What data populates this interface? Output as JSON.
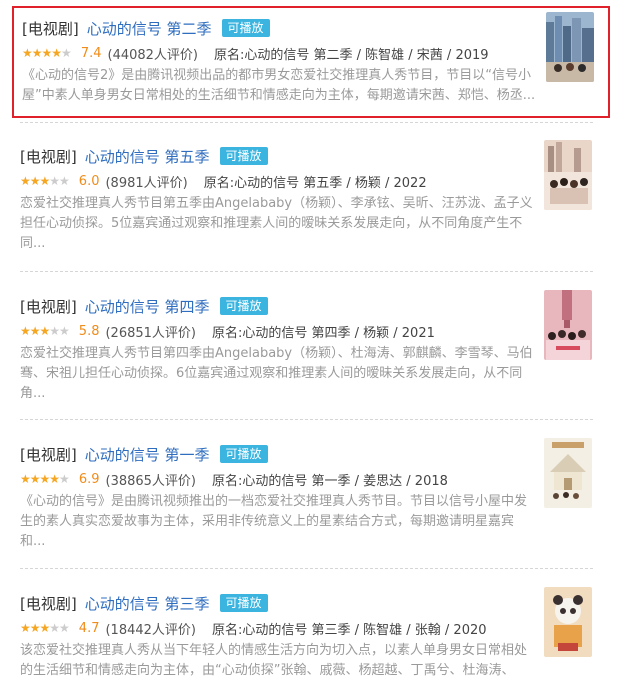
{
  "results": [
    {
      "category": "[电视剧]",
      "title": "心动的信号 第二季",
      "badge": "可播放",
      "score": "7.4",
      "count": "(44082人评价)",
      "original": "原名:心动的信号 第二季 / 陈智雄 / 宋茜 / 2019",
      "desc": "《心动的信号2》是由腾讯视频出品的都市男女恋爱社交推理真人秀节目，节目以“信号小屋”中素人单身男女日常相处的生活细节和情感走向为主体，每期邀请宋茜、郑恺、杨丞...",
      "stars": 3.5,
      "poster_icon": "poster-city-skyline"
    },
    {
      "category": "[电视剧]",
      "title": "心动的信号 第五季",
      "badge": "可播放",
      "score": "6.0",
      "count": "(8981人评价)",
      "original": "原名:心动的信号 第五季 / 杨颖 / 2022",
      "desc": "恋爱社交推理真人秀节目第五季由Angelababy（杨颖）、李承铉、吴昕、汪苏泷、孟子义担任心动侦探。5位嘉宾通过观察和推理素人间的暧昧关系发展走向，从不同角度产生不同...",
      "stars": 3,
      "poster_icon": "poster-group-city"
    },
    {
      "category": "[电视剧]",
      "title": "心动的信号 第四季",
      "badge": "可播放",
      "score": "5.8",
      "count": "(26851人评价)",
      "original": "原名:心动的信号 第四季 / 杨颖 / 2021",
      "desc": "恋爱社交推理真人秀节目第四季由Angelababy（杨颖）、杜海涛、郭麒麟、李雪琴、马伯骞、宋祖儿担任心动侦探。6位嘉宾通过观察和推理素人间的暧昧关系发展走向，从不同角...",
      "stars": 3,
      "poster_icon": "poster-group-pink"
    },
    {
      "category": "[电视剧]",
      "title": "心动的信号 第一季",
      "badge": "可播放",
      "score": "6.9",
      "count": "(38865人评价)",
      "original": "原名:心动的信号 第一季 / 姜思达 / 2018",
      "desc": "《心动的信号》是由腾讯视频推出的一档恋爱社交推理真人秀节目。节目以信号小屋中发生的素人真实恋爱故事为主体，采用非传统意义上的星素结合方式，每期邀请明星嘉宾和...",
      "stars": 3.5,
      "poster_icon": "poster-house"
    },
    {
      "category": "[电视剧]",
      "title": "心动的信号 第三季",
      "badge": "可播放",
      "score": "4.7",
      "count": "(18442人评价)",
      "original": "原名:心动的信号 第三季 / 陈智雄 / 张翰 / 2020",
      "desc": "该恋爱社交推理真人秀从当下年轻人的情感生活方向为切入点，以素人单身男女日常相处的生活细节和情感走向为主体，由“心动侦探”张翰、戚薇、杨超越、丁禹兮、杜海涛、A...",
      "stars": 2.5,
      "poster_icon": "poster-bear"
    }
  ]
}
